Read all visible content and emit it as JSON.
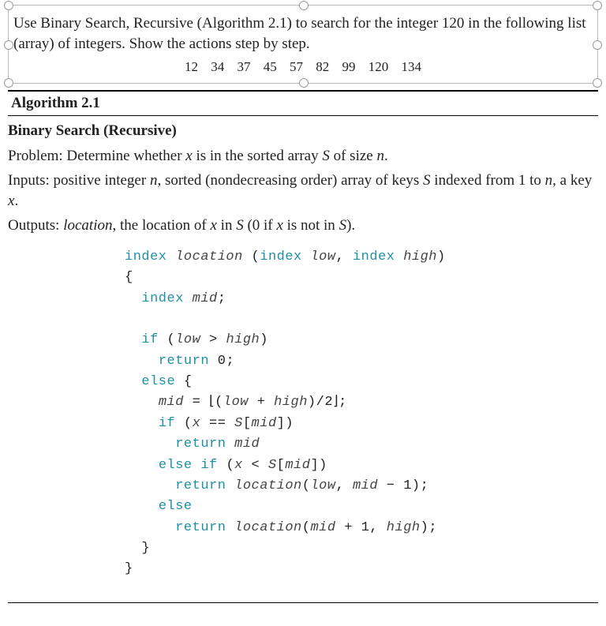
{
  "problem": {
    "line1": "Use Binary Search, Recursive (Algorithm 2.1) to search for the integer 120 in the following list (array) of integers. Show the actions step by step.",
    "array": "12   34   37   45   57   82   99   120   134"
  },
  "algo": {
    "label": "Algorithm 2.1",
    "name": "Binary Search (Recursive)",
    "problem_prefix": "Problem: Determine whether ",
    "problem_mid1": " is in the sorted array ",
    "problem_mid2": " of size ",
    "problem_end": ".",
    "x": "x",
    "S": "S",
    "n": "n",
    "inputs_prefix": "Inputs: positive integer ",
    "inputs_mid1": ", sorted (nondecreasing order) array of keys ",
    "inputs_mid2": " indexed from 1 to ",
    "inputs_mid3": ", a key ",
    "inputs_end": ".",
    "outputs_prefix": "Outputs: ",
    "location": "location",
    "outputs_mid1": ", the location of ",
    "outputs_mid2": " in ",
    "outputs_mid3": " (0 if ",
    "outputs_mid4": " is not in ",
    "outputs_end": ")."
  },
  "code": {
    "kw_index": "index",
    "kw_if": "if",
    "kw_return": "return",
    "kw_else": "else",
    "kw_elseif": "else if",
    "location": "location",
    "low": "low",
    "high": "high",
    "mid": "mid",
    "x": "x",
    "S": "S",
    "zero": "0",
    "one": "1",
    "two": "2",
    "lbr": "{",
    "rbr": "}",
    "semi": ";",
    "comma": ",",
    "lpar": "(",
    "rpar": ")",
    "gt": ">",
    "lt": "<",
    "eq": "==",
    "assign": "=",
    "plus": "+",
    "minus": "−",
    "floorL": "⌊",
    "floorR": "⌋",
    "slash": "/",
    "lbrk": "[",
    "rbrk": "]"
  }
}
